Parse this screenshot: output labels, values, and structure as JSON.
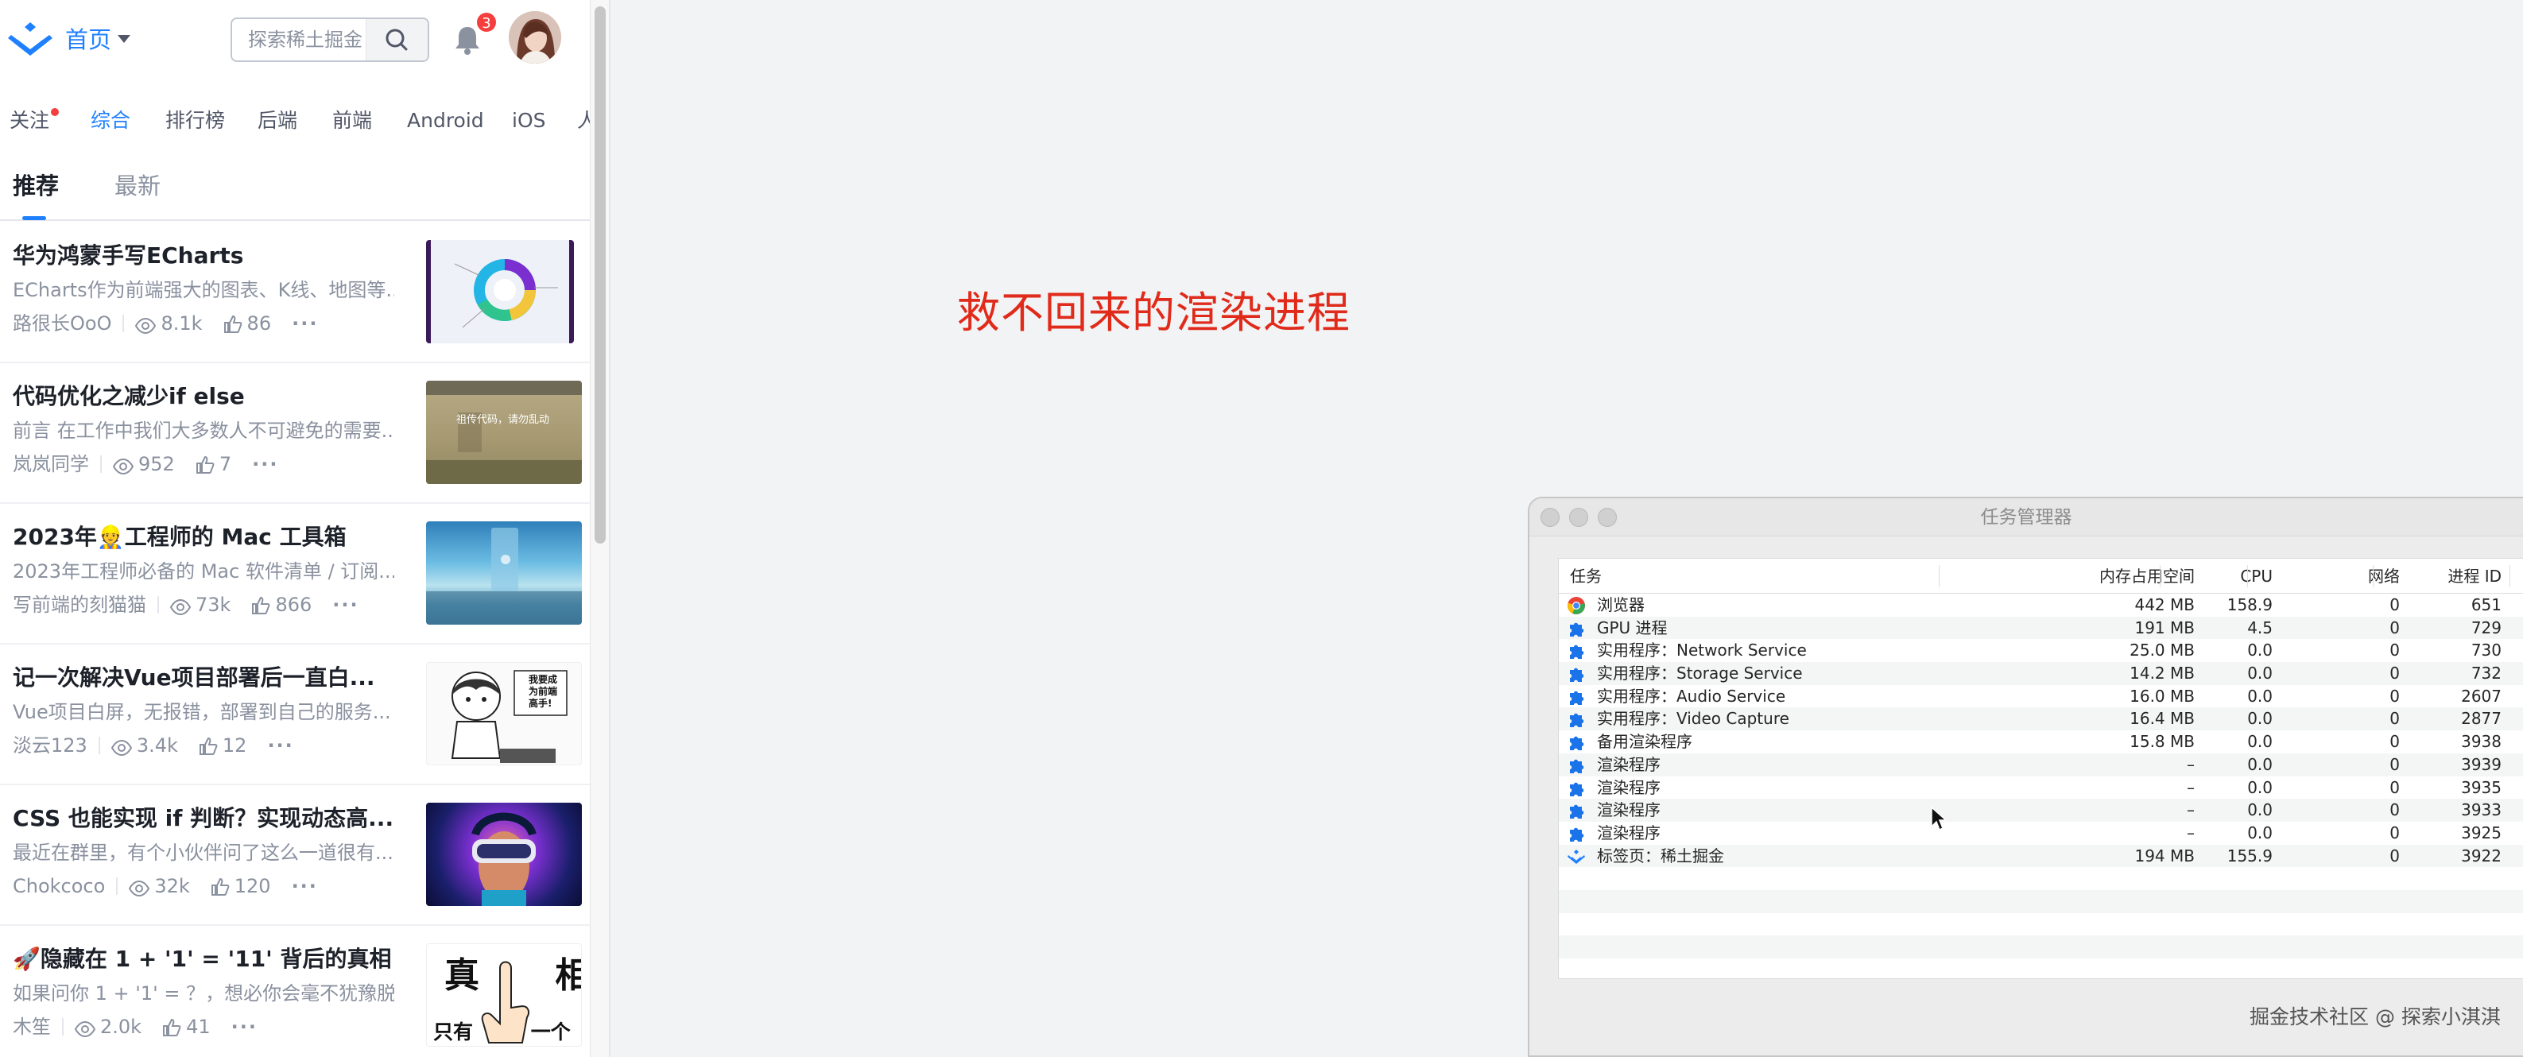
{
  "header": {
    "home_label": "首页",
    "search_placeholder": "探索稀土掘金",
    "notification_count": "3"
  },
  "channels": [
    "关注",
    "综合",
    "排行榜",
    "后端",
    "前端",
    "Android",
    "iOS",
    "人"
  ],
  "channel_active": "综合",
  "sub_tabs": [
    "推荐",
    "最新"
  ],
  "articles": [
    {
      "title": "华为鸿蒙手写ECharts",
      "abstract": "ECharts作为前端强大的图表、K线、地图等...",
      "author": "路很长OoO",
      "views": "8.1k",
      "likes": "86",
      "more": "···"
    },
    {
      "title": "代码优化之减少if else",
      "abstract": "前言 在工作中我们大多数人不可避免的需要...",
      "author": "岚岚同学",
      "views": "952",
      "likes": "7",
      "more": "···",
      "thumb_caption": "祖传代码，请勿乱动"
    },
    {
      "title": "2023年👷工程师的 Mac 工具箱",
      "abstract": "2023年工程师必备的 Mac 软件清单 / 订阅...",
      "author": "写前端的刻猫猫",
      "views": "73k",
      "likes": "866",
      "more": "···"
    },
    {
      "title": "记一次解决Vue项目部署后一直白...",
      "abstract": "Vue项目白屏，无报错，部署到自己的服务...",
      "author": "淡云123",
      "views": "3.4k",
      "likes": "12",
      "more": "···",
      "thumb_caption": "我要成为前端高手!"
    },
    {
      "title": "CSS 也能实现 if 判断？实现动态高...",
      "abstract": "最近在群里，有个小伙伴问了这么一道很有...",
      "author": "Chokcoco",
      "views": "32k",
      "likes": "120",
      "more": "···"
    },
    {
      "title": "🚀隐藏在 1 + '1' = '11' 背后的真相",
      "abstract": "如果问你 1 + '1' = ？，想必你会毫不犹豫脱...",
      "author": "木笙",
      "views": "2.0k",
      "likes": "41",
      "more": "···",
      "thumb_caption_top": "真 相",
      "thumb_caption_bottom": "只有 一个"
    }
  ],
  "annotation": "救不回来的渲染进程",
  "task_manager": {
    "title": "任务管理器",
    "columns": [
      "任务",
      "内存占用空间",
      "CPU",
      "网络",
      "进程 ID"
    ],
    "rows": [
      {
        "icon": "chrome-icon",
        "name": "浏览器",
        "memory": "442 MB",
        "cpu": "158.9",
        "network": "0",
        "pid": "651"
      },
      {
        "icon": "puzzle-icon",
        "name": "GPU 进程",
        "memory": "191 MB",
        "cpu": "4.5",
        "network": "0",
        "pid": "729"
      },
      {
        "icon": "puzzle-icon",
        "name": "实用程序：Network Service",
        "memory": "25.0 MB",
        "cpu": "0.0",
        "network": "0",
        "pid": "730"
      },
      {
        "icon": "puzzle-icon",
        "name": "实用程序：Storage Service",
        "memory": "14.2 MB",
        "cpu": "0.0",
        "network": "0",
        "pid": "732"
      },
      {
        "icon": "puzzle-icon",
        "name": "实用程序：Audio Service",
        "memory": "16.0 MB",
        "cpu": "0.0",
        "network": "0",
        "pid": "2607"
      },
      {
        "icon": "puzzle-icon",
        "name": "实用程序：Video Capture",
        "memory": "16.4 MB",
        "cpu": "0.0",
        "network": "0",
        "pid": "2877"
      },
      {
        "icon": "puzzle-icon",
        "name": "备用渲染程序",
        "memory": "15.8 MB",
        "cpu": "0.0",
        "network": "0",
        "pid": "3938"
      },
      {
        "icon": "puzzle-icon",
        "name": "渲染程序",
        "memory": "–",
        "cpu": "0.0",
        "network": "0",
        "pid": "3939"
      },
      {
        "icon": "puzzle-icon",
        "name": "渲染程序",
        "memory": "–",
        "cpu": "0.0",
        "network": "0",
        "pid": "3935"
      },
      {
        "icon": "puzzle-icon",
        "name": "渲染程序",
        "memory": "–",
        "cpu": "0.0",
        "network": "0",
        "pid": "3933"
      },
      {
        "icon": "puzzle-icon",
        "name": "渲染程序",
        "memory": "–",
        "cpu": "0.0",
        "network": "0",
        "pid": "3925"
      },
      {
        "icon": "juejin-icon",
        "name": "标签页：稀土掘金",
        "memory": "194 MB",
        "cpu": "155.9",
        "network": "0",
        "pid": "3922"
      }
    ]
  },
  "watermark": "掘金技术社区 @ 探索小淇淇",
  "colors": {
    "brand": "#1e80ff",
    "annotation": "#e02a1a",
    "badge": "#f53f3f"
  }
}
